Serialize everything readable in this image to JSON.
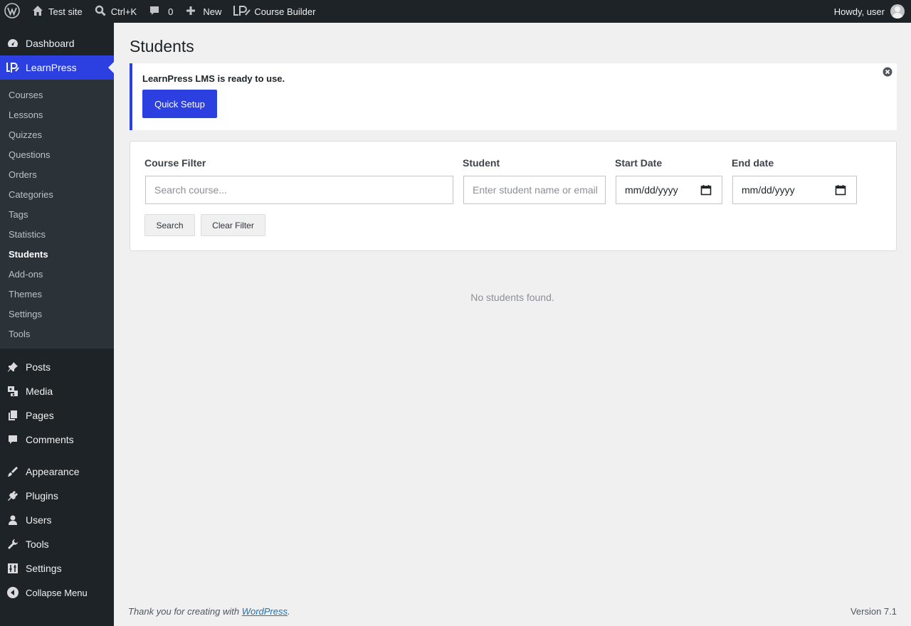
{
  "adminbar": {
    "site_name": "Test site",
    "search_shortcut": "Ctrl+K",
    "comments_count": "0",
    "new_label": "New",
    "course_builder_label": "Course Builder",
    "howdy": "Howdy, user"
  },
  "sidebar": {
    "dashboard": "Dashboard",
    "learnpress": "LearnPress",
    "learnpress_sub": [
      "Courses",
      "Lessons",
      "Quizzes",
      "Questions",
      "Orders",
      "Categories",
      "Tags",
      "Statistics",
      "Students",
      "Add-ons",
      "Themes",
      "Settings",
      "Tools"
    ],
    "posts": "Posts",
    "media": "Media",
    "pages": "Pages",
    "comments": "Comments",
    "appearance": "Appearance",
    "plugins": "Plugins",
    "users": "Users",
    "tools": "Tools",
    "settings": "Settings",
    "collapse": "Collapse Menu"
  },
  "page": {
    "title": "Students"
  },
  "notice": {
    "message": "LearnPress LMS is ready to use.",
    "button": "Quick Setup"
  },
  "filters": {
    "course_label": "Course Filter",
    "course_placeholder": "Search course...",
    "student_label": "Student",
    "student_placeholder": "Enter student name or email",
    "start_label": "Start Date",
    "start_value": "mm/dd/yyyy",
    "end_label": "End date",
    "end_value": "mm/dd/yyyy",
    "search_button": "Search",
    "clear_button": "Clear Filter"
  },
  "empty_message": "No students found.",
  "footer": {
    "thanks_prefix": "Thank you for creating with ",
    "wordpress_link": "WordPress",
    "thanks_suffix": ".",
    "version": "Version 7.1"
  },
  "colors": {
    "accent": "#2c3fe0",
    "adminbar_bg": "#1d2327",
    "submenu_bg": "#2c3338",
    "page_bg": "#f0f0f1"
  }
}
